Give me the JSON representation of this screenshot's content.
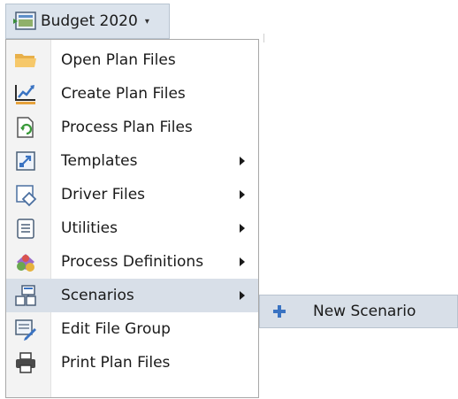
{
  "toolbar": {
    "dropdown_label": "Budget 2020",
    "dropdown_icon": "plan-budget-icon",
    "caret_glyph": "▾"
  },
  "menu": {
    "items": [
      {
        "label": "Open Plan Files",
        "icon": "folder-icon",
        "has_submenu": false
      },
      {
        "label": "Create Plan Files",
        "icon": "create-chart-icon",
        "has_submenu": false
      },
      {
        "label": "Process Plan Files",
        "icon": "process-file-icon",
        "has_submenu": false
      },
      {
        "label": "Templates",
        "icon": "templates-icon",
        "has_submenu": true
      },
      {
        "label": "Driver Files",
        "icon": "driver-files-icon",
        "has_submenu": true
      },
      {
        "label": "Utilities",
        "icon": "utilities-icon",
        "has_submenu": true
      },
      {
        "label": "Process Definitions",
        "icon": "process-definitions-icon",
        "has_submenu": true
      },
      {
        "label": "Scenarios",
        "icon": "scenarios-icon",
        "has_submenu": true,
        "active": true
      },
      {
        "label": "Edit File Group",
        "icon": "edit-file-group-icon",
        "has_submenu": false
      },
      {
        "label": "Print Plan Files",
        "icon": "printer-icon",
        "has_submenu": false
      }
    ]
  },
  "submenu": {
    "items": [
      {
        "label": "New Scenario",
        "icon": "plus-icon"
      }
    ]
  },
  "colors": {
    "highlight": "#d8dfe8",
    "accent_blue": "#3a73c2",
    "gutter": "#f3f3f3"
  }
}
